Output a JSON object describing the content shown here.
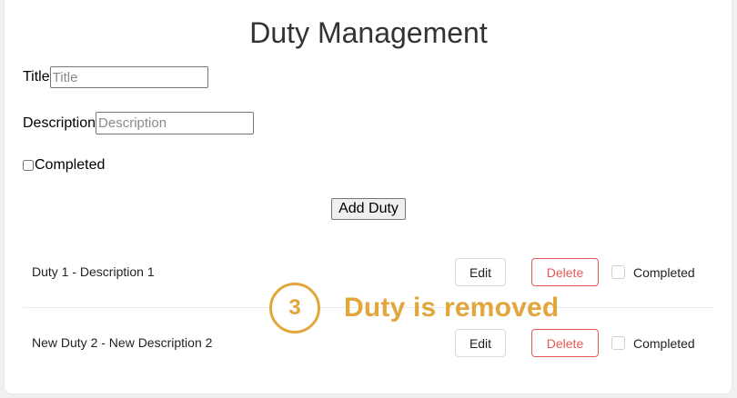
{
  "page": {
    "title": "Duty Management"
  },
  "form": {
    "title_label": "Title",
    "title_placeholder": "Title",
    "description_label": "Description",
    "description_placeholder": "Description",
    "completed_label": "Completed",
    "add_button_label": "Add Duty"
  },
  "duties": [
    {
      "text": "Duty 1 - Description 1",
      "edit_label": "Edit",
      "delete_label": "Delete",
      "completed_label": "Completed",
      "completed": false
    },
    {
      "text": "New Duty 2 - New Description 2",
      "edit_label": "Edit",
      "delete_label": "Delete",
      "completed_label": "Completed",
      "completed": false
    }
  ],
  "annotation": {
    "step": "3",
    "text": "Duty is removed"
  },
  "colors": {
    "accent": "#e2a63c",
    "delete": "#e05a5a"
  }
}
